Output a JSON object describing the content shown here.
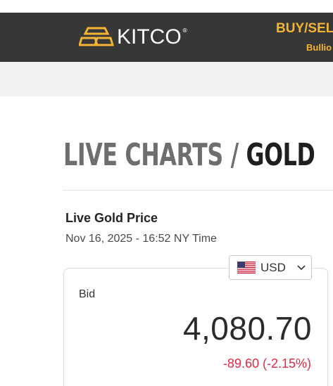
{
  "header": {
    "logo_text": "KITCO",
    "logo_reg": "®",
    "buy_sell": "BUY/SEL",
    "bullion": "Bullio"
  },
  "page": {
    "title_part1": "LIVE CHARTS",
    "title_sep": "/",
    "title_part2": "GOLD",
    "live_label": "Live Gold Price",
    "timestamp": "Nov 16, 2025 - 16:52 NY Time"
  },
  "price_card": {
    "bid_label": "Bid",
    "price": "4,080.70",
    "change": "-89.60 (-2.15%)"
  },
  "currency": {
    "selected": "USD",
    "flag_icon": "us-flag-icon"
  },
  "colors": {
    "header_bg": "#373737",
    "accent_gold": "#f4b433",
    "negative": "#e5293f"
  }
}
